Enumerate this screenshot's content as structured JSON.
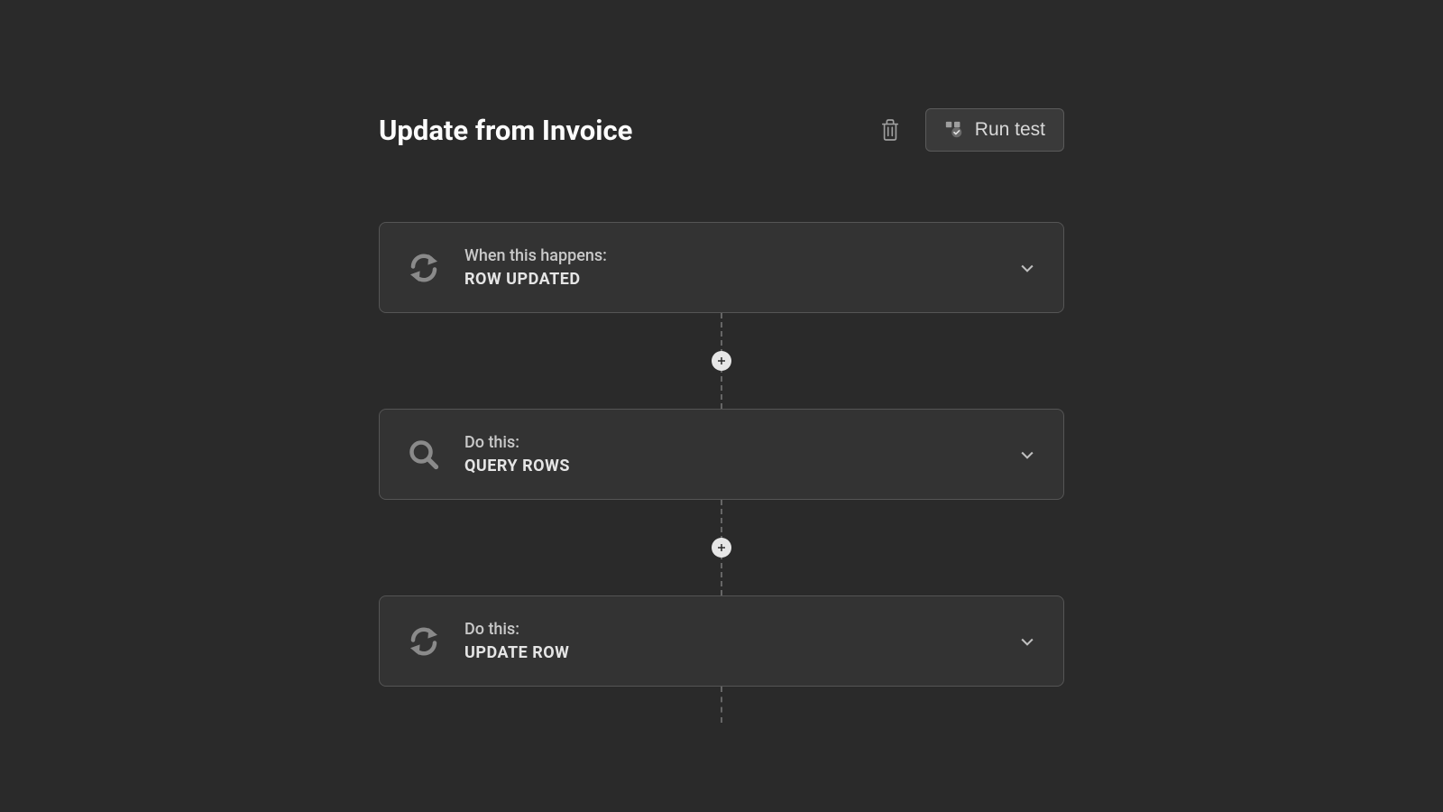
{
  "header": {
    "title": "Update from Invoice",
    "run_test_label": "Run test"
  },
  "steps": [
    {
      "label": "When this happens:",
      "action": "ROW UPDATED",
      "icon": "refresh"
    },
    {
      "label": "Do this:",
      "action": "QUERY ROWS",
      "icon": "search"
    },
    {
      "label": "Do this:",
      "action": "UPDATE ROW",
      "icon": "refresh"
    }
  ]
}
